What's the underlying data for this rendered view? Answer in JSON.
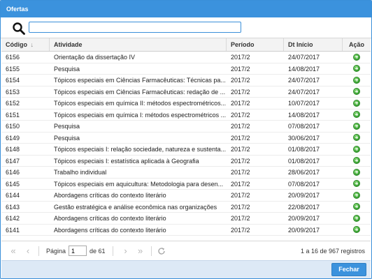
{
  "window": {
    "title": "Ofertas"
  },
  "search": {
    "value": "",
    "placeholder": ""
  },
  "grid": {
    "columns": {
      "codigo": "Código",
      "atividade": "Atividade",
      "periodo": "Período",
      "dt_inicio": "Dt Início",
      "acao": "Ação"
    },
    "sort_indicator": "↓",
    "rows": [
      {
        "codigo": "6156",
        "atividade": "Orientação da dissertação IV",
        "periodo": "2017/2",
        "dt_inicio": "24/07/2017"
      },
      {
        "codigo": "6155",
        "atividade": "Pesquisa",
        "periodo": "2017/2",
        "dt_inicio": "14/08/2017"
      },
      {
        "codigo": "6154",
        "atividade": "Tópicos especiais em Ciências Farmacêuticas: Técnicas pa...",
        "periodo": "2017/2",
        "dt_inicio": "24/07/2017"
      },
      {
        "codigo": "6153",
        "atividade": "Tópicos especiais em Ciências Farmacêuticas: redação de ...",
        "periodo": "2017/2",
        "dt_inicio": "24/07/2017"
      },
      {
        "codigo": "6152",
        "atividade": "Tópicos especiais em química II: métodos espectrométricos...",
        "periodo": "2017/2",
        "dt_inicio": "10/07/2017"
      },
      {
        "codigo": "6151",
        "atividade": "Tópicos especiais em química I: métodos espectrométricos ...",
        "periodo": "2017/2",
        "dt_inicio": "14/08/2017"
      },
      {
        "codigo": "6150",
        "atividade": "Pesquisa",
        "periodo": "2017/2",
        "dt_inicio": "07/08/2017"
      },
      {
        "codigo": "6149",
        "atividade": "Pesquisa",
        "periodo": "2017/2",
        "dt_inicio": "30/06/2017"
      },
      {
        "codigo": "6148",
        "atividade": "Tópicos especiais I: relação sociedade, natureza e sustenta...",
        "periodo": "2017/2",
        "dt_inicio": "01/08/2017"
      },
      {
        "codigo": "6147",
        "atividade": "Tópicos especiais I: estatística aplicada à Geografia",
        "periodo": "2017/2",
        "dt_inicio": "01/08/2017"
      },
      {
        "codigo": "6146",
        "atividade": "Trabalho individual",
        "periodo": "2017/2",
        "dt_inicio": "28/06/2017"
      },
      {
        "codigo": "6145",
        "atividade": "Tópicos especiais em aquicultura: Metodologia para desen...",
        "periodo": "2017/2",
        "dt_inicio": "07/08/2017"
      },
      {
        "codigo": "6144",
        "atividade": "Abordagens críticas do contexto literário",
        "periodo": "2017/2",
        "dt_inicio": "20/09/2017"
      },
      {
        "codigo": "6143",
        "atividade": "Gestão estratégica e análise econômica nas organizações",
        "periodo": "2017/2",
        "dt_inicio": "22/08/2017"
      },
      {
        "codigo": "6142",
        "atividade": "Abordagens críticas do contexto literário",
        "periodo": "2017/2",
        "dt_inicio": "20/09/2017"
      },
      {
        "codigo": "6141",
        "atividade": "Abordagens críticas do contexto literário",
        "periodo": "2017/2",
        "dt_inicio": "20/09/2017"
      }
    ]
  },
  "pager": {
    "page_label": "Página",
    "page_value": "1",
    "of_label": "de 61",
    "records": "1 a 16 de 967 registros"
  },
  "footer": {
    "close_label": "Fechar"
  },
  "colors": {
    "accent": "#3b92dd",
    "add": "#3aa133"
  }
}
